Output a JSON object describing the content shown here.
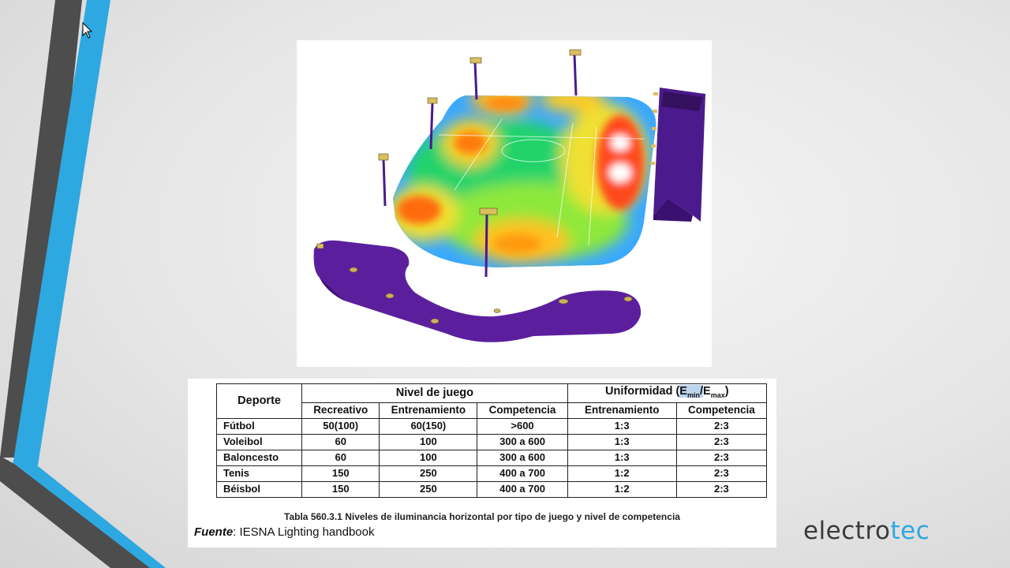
{
  "table": {
    "header": {
      "sport": "Deporte",
      "level": "Nivel de juego",
      "uniformity": {
        "prefix": "Uniformidad (",
        "e1": "E",
        "sub1": "min",
        "slash": "/",
        "e2": "E",
        "sub2": "max",
        "suffix": ")"
      }
    },
    "subheaders": [
      "Recreativo",
      "Entrenamiento",
      "Competencia",
      "Entrenamiento",
      "Competencia"
    ],
    "rows": [
      {
        "sport": "Fútbol",
        "rec": "50(100)",
        "ent": "60(150)",
        "comp": ">600",
        "u_ent": "1:3",
        "u_comp": "2:3"
      },
      {
        "sport": "Voleibol",
        "rec": "60",
        "ent": "100",
        "comp": "300 a 600",
        "u_ent": "1:3",
        "u_comp": "2:3"
      },
      {
        "sport": "Baloncesto",
        "rec": "60",
        "ent": "100",
        "comp": "300 a 600",
        "u_ent": "1:3",
        "u_comp": "2:3"
      },
      {
        "sport": "Tenis",
        "rec": "150",
        "ent": "250",
        "comp": "400 a 700",
        "u_ent": "1:2",
        "u_comp": "2:3"
      },
      {
        "sport": "Béisbol",
        "rec": "150",
        "ent": "250",
        "comp": "400 a 700",
        "u_ent": "1:2",
        "u_comp": "2:3"
      }
    ],
    "caption": "Tabla 560.3.1  Niveles de iluminancia horizontal por tipo de juego y nivel de competencia",
    "source_label": "Fuente",
    "source_text": ": IESNA Lighting handbook"
  },
  "logo": {
    "part1": "electro",
    "part2": "tec"
  },
  "colors": {
    "accent_blue": "#2ea8e0",
    "dark_stripe": "#4a4a4a",
    "logo_gray": "#3a3a3a",
    "highlight": "#bcd5ee"
  }
}
